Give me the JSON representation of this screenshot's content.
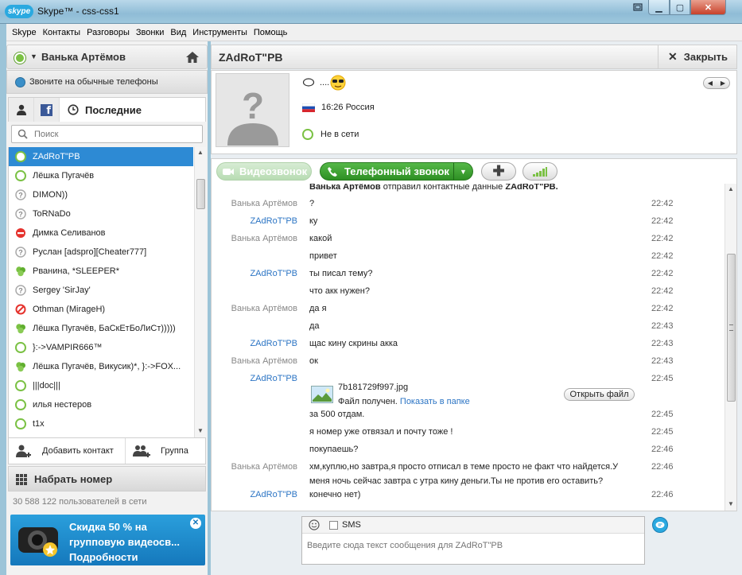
{
  "window": {
    "title": "Skype™ - css-css1",
    "logo": "skype"
  },
  "menu": [
    "Skype",
    "Контакты",
    "Разговоры",
    "Звонки",
    "Вид",
    "Инструменты",
    "Помощь"
  ],
  "profile": {
    "name": "Ванька Артёмов",
    "status_color": "#7ac143"
  },
  "call_phones": "Звоните на обычные телефоны",
  "tabs": {
    "recent": "Последние"
  },
  "search": {
    "placeholder": "Поиск"
  },
  "contacts": [
    {
      "name": "ZAdRoT\"PB",
      "status": "online-outline",
      "selected": true
    },
    {
      "name": "Лёшка Пугачёв",
      "status": "online-outline"
    },
    {
      "name": "DIMON))",
      "status": "unknown"
    },
    {
      "name": "ToRNaDo",
      "status": "unknown"
    },
    {
      "name": "Димка Селиванов",
      "status": "dnd"
    },
    {
      "name": "Руслан [adspro][Cheater777]",
      "status": "unknown"
    },
    {
      "name": "Рванина, *SLEEPER*",
      "status": "group"
    },
    {
      "name": "Sergey 'SirJay'",
      "status": "unknown"
    },
    {
      "name": "Othman (MirageH)",
      "status": "blocked"
    },
    {
      "name": "Лёшка Пугачёв, БаСкЕтБоЛиСт)))))",
      "status": "group"
    },
    {
      "name": "}:->VAMPIR666™",
      "status": "online-outline"
    },
    {
      "name": "Лёшка Пугачёв, Викусик)*, }:->FOX...",
      "status": "group"
    },
    {
      "name": "|||doc|||",
      "status": "online-outline"
    },
    {
      "name": "илья нестеров",
      "status": "online-outline"
    },
    {
      "name": "t1x",
      "status": "online-outline"
    }
  ],
  "add_contact": "Добавить контакт",
  "group": "Группа",
  "dial": "Набрать номер",
  "online_count": "30 588 122 пользователей в сети",
  "ad": {
    "line1": "Скидка 50 % на",
    "line2": "групповую видеосв...",
    "line3": "Подробности"
  },
  "chat": {
    "title": "ZAdRoT\"PB",
    "close": "Закрыть",
    "mood": "....",
    "location": "16:26 Россия",
    "status": "Не в сети",
    "video_call": "Видеозвонок",
    "phone_call": "Телефонный звонок",
    "top_line_sender": "Ванька Артёмов",
    "top_line_mid": " отправил контактные данные ",
    "top_line_target": "ZAdRoT\"PB.",
    "messages": [
      {
        "sender": "Ванька Артёмов",
        "who": "me",
        "text": "?",
        "time": "22:42"
      },
      {
        "sender": "ZAdRoT\"PB",
        "who": "them",
        "text": "ку",
        "time": "22:42"
      },
      {
        "sender": "Ванька Артёмов",
        "who": "me",
        "text": "какой",
        "time": "22:42"
      },
      {
        "sender": "",
        "who": "me",
        "text": "привет",
        "time": "22:42"
      },
      {
        "sender": "ZAdRoT\"PB",
        "who": "them",
        "text": "ты писал тему?",
        "time": "22:42"
      },
      {
        "sender": "",
        "who": "them",
        "text": "что акк нужен?",
        "time": "22:42"
      },
      {
        "sender": "Ванька Артёмов",
        "who": "me",
        "text": "да я",
        "time": "22:42"
      },
      {
        "sender": "",
        "who": "me",
        "text": "да",
        "time": "22:43"
      },
      {
        "sender": "ZAdRoT\"PB",
        "who": "them",
        "text": "щас кину скрины акка",
        "time": "22:43"
      },
      {
        "sender": "Ванька Артёмов",
        "who": "me",
        "text": "ок",
        "time": "22:43"
      },
      {
        "sender": "ZAdRoT\"PB",
        "who": "them",
        "text": "",
        "time": "22:45"
      },
      {
        "sender": "",
        "who": "them",
        "text": "за 500 отдам.",
        "time": "22:45"
      },
      {
        "sender": "",
        "who": "them",
        "text": "я номер уже отвязал и почту тоже !",
        "time": "22:45"
      },
      {
        "sender": "",
        "who": "them",
        "text": "покупаешь?",
        "time": "22:46"
      },
      {
        "sender": "Ванька Артёмов",
        "who": "me",
        "text": "хм,куплю,но завтра,я просто отписал в теме просто не факт что найдется.У меня ночь сейчас завтра с утра кину деньги.Ты не против его оставить?",
        "time": "22:46"
      },
      {
        "sender": "ZAdRoT\"PB",
        "who": "them",
        "text": "конечно нет)",
        "time": "22:46"
      }
    ],
    "file": {
      "name": "7b181729f997.jpg",
      "received": "Файл получен.",
      "show_in_folder": "Показать в папке",
      "open": "Открыть файл"
    },
    "sms_label": "SMS",
    "input_placeholder": "Введите сюда текст сообщения для ZAdRoT\"PB"
  }
}
